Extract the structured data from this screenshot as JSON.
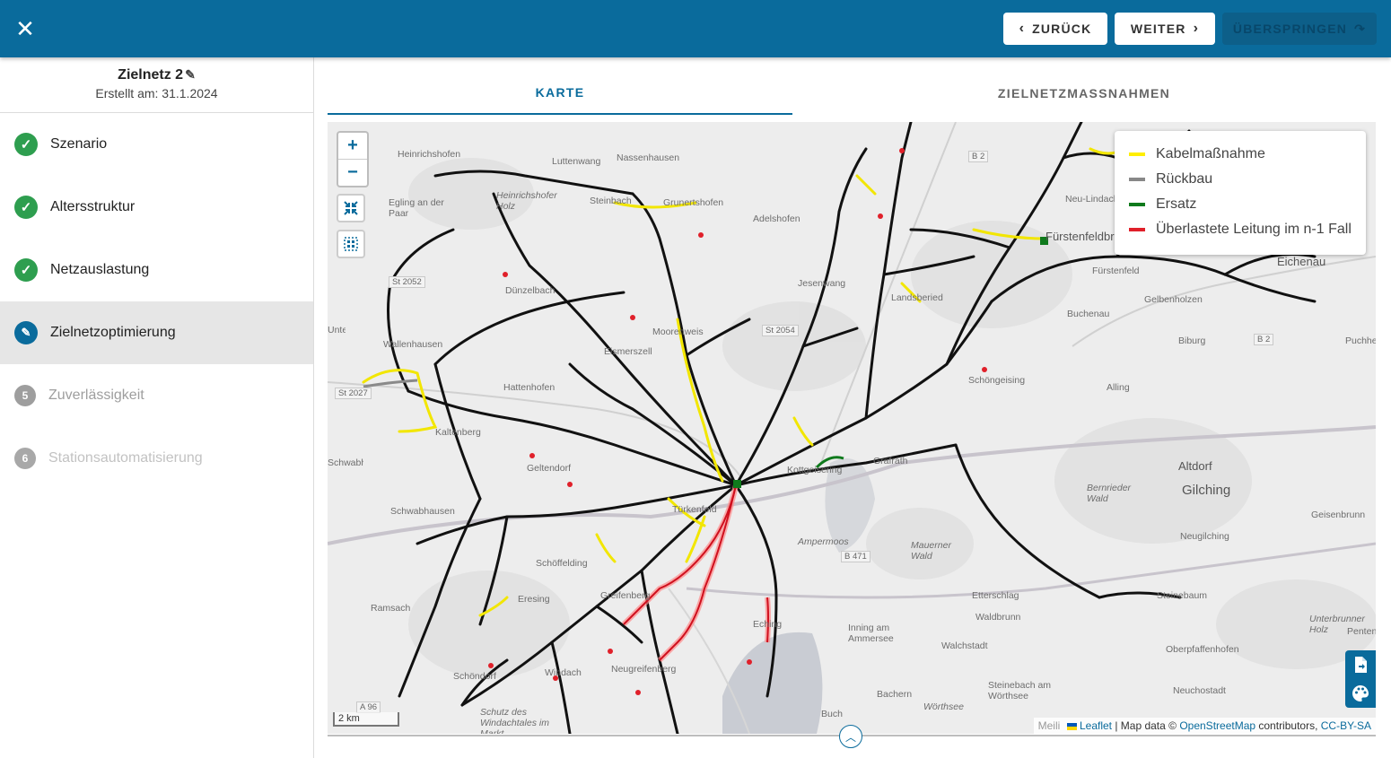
{
  "topbar": {
    "back_label": "ZURÜCK",
    "next_label": "WEITER",
    "skip_label": "ÜBERSPRINGEN",
    "color": "#0a6b9c"
  },
  "sidebar": {
    "title": "Zielnetz 2",
    "created": "Erstellt am: 31.1.2024",
    "steps": [
      {
        "label": "Szenario",
        "state": "done"
      },
      {
        "label": "Altersstruktur",
        "state": "done"
      },
      {
        "label": "Netzauslastung",
        "state": "done"
      },
      {
        "label": "Zielnetzoptimierung",
        "state": "active"
      },
      {
        "label": "Zuverlässigkeit",
        "state": "pending",
        "number": "5"
      },
      {
        "label": "Stationsautomatisierung",
        "state": "disabled",
        "number": "6"
      }
    ]
  },
  "tabs": {
    "map": "KARTE",
    "measures": "ZIELNETZMASSNAHMEN"
  },
  "map": {
    "zoom_in": "+",
    "zoom_out": "−",
    "scale": "2 km",
    "attribution": {
      "prefix": "Meili",
      "leaflet": "Leaflet",
      "data": " | Map data © ",
      "osm": "OpenStreetMap",
      "contrib": " contributors, ",
      "license": "CC-BY-SA"
    },
    "legend": [
      {
        "label": "Kabelmaßnahme",
        "color": "#ffee00"
      },
      {
        "label": "Rückbau",
        "color": "#888888"
      },
      {
        "label": "Ersatz",
        "color": "#0f7a1c"
      },
      {
        "label": "Überlastete Leitung im n-1 Fall",
        "color": "#e0202a"
      }
    ],
    "places": {
      "p1": "Heinrichshofen",
      "p2": "Luttenwang",
      "p3": "Nassenhausen",
      "p4": "Egling an der Paar",
      "p5": "Heinrichshofer Holz",
      "p6": "Steinbach",
      "p7": "Grunertshofen",
      "p8": "Adelshofen",
      "p9": "Jesenwang",
      "p10": "Landsberied",
      "p11": "Fürstenfeldbruck",
      "p12": "Neu-Lindach",
      "p13": "Fürstenfeld",
      "p14": "Eichenau",
      "p15": "Gelbenholzen",
      "p16": "Buchenau",
      "p17": "Biburg",
      "p18": "Puchheim-Ort",
      "p19": "Dünzelbach",
      "p20": "Moorenweis",
      "p21": "Eismerszell",
      "p22": "Wallenhausen",
      "p23": "Hattenhofen",
      "p24": "Schöngeising",
      "p25": "Alling",
      "p26": "Kaltenberg",
      "p27": "Geltendorf",
      "p28": "Türkenfeld",
      "p29": "Grafrath",
      "p30": "Kottgeisering",
      "p31": "Altdorf",
      "p32": "Gilching",
      "p33": "Geisenbrunn",
      "p34": "Schwabhausen",
      "p35": "Ampermoos",
      "p36": "Mauerner Wald",
      "p37": "Neugilching",
      "p38": "Schöffelding",
      "p39": "Greifenberg",
      "p40": "Etterschlag",
      "p41": "Steinebaum",
      "p42": "Ramsach",
      "p43": "Eresing",
      "p44": "Inning am Ammersee",
      "p45": "Waldbrunn",
      "p46": "Unterbrunner Holz",
      "p47": "Pentenried",
      "p48": "Oberpfaffenhofen",
      "p49": "Walchstadt",
      "p50": "Steinebach am Wörthsee",
      "p51": "Neuchostadt",
      "p52": "Schöndorf",
      "p53": "Windach",
      "p54": "Neugreifenberg",
      "p55": "Bachern",
      "p56": "Buch",
      "p57": "Schutz des Windachtales im Markt",
      "p58": "Wörthsee",
      "p59": "Unterdießen",
      "p60": "Eching",
      "p61": "Schwabhausen",
      "p62": "Bernrieder Wald"
    },
    "roads": {
      "r1": "St 2052",
      "r2": "St 2054",
      "r3": "St 2027",
      "r4": "B 2",
      "r5": "B 471",
      "r6": "A 96",
      "r7": "B 2"
    }
  }
}
